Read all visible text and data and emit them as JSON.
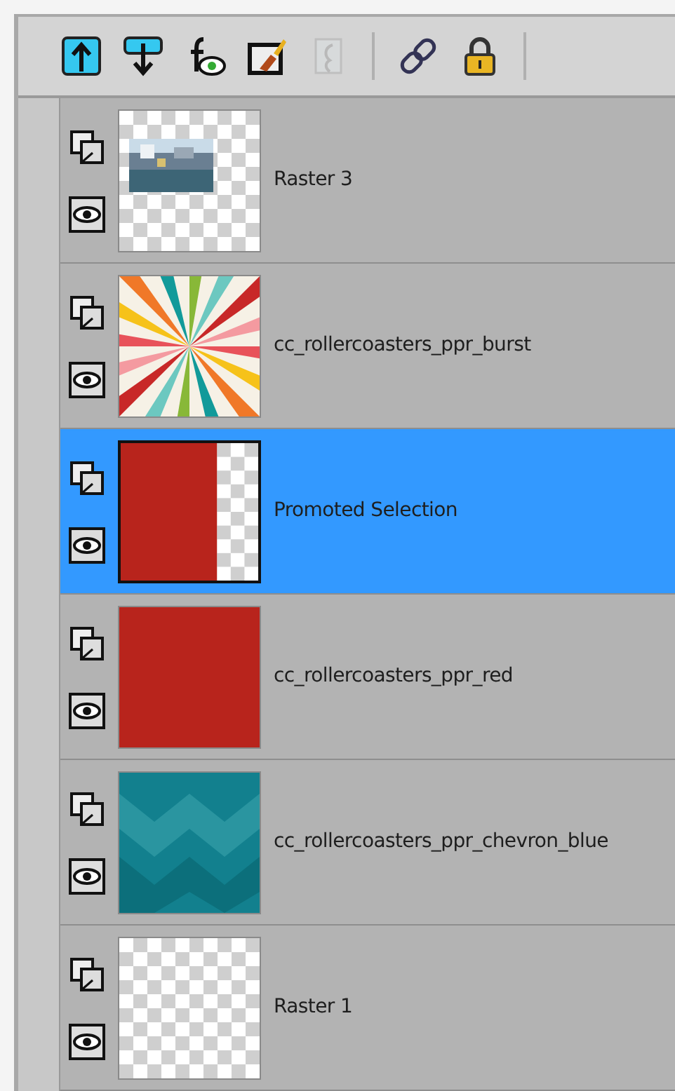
{
  "toolbar": [
    {
      "kind": "up",
      "disabled": false
    },
    {
      "kind": "down",
      "disabled": false
    },
    {
      "kind": "fx",
      "disabled": false
    },
    {
      "kind": "edit",
      "disabled": false
    },
    {
      "kind": "mask",
      "disabled": true
    },
    {
      "kind": "sep"
    },
    {
      "kind": "link",
      "disabled": false
    },
    {
      "kind": "lock",
      "disabled": false
    },
    {
      "kind": "sep"
    }
  ],
  "layers": [
    {
      "name": "Raster 3",
      "selected": false
    },
    {
      "name": "cc_rollercoasters_ppr_burst",
      "selected": false,
      "kind": "burst"
    },
    {
      "name": "Promoted Selection",
      "selected": true,
      "kind": "partial"
    },
    {
      "name": "cc_rollercoasters_ppr_red",
      "selected": false,
      "kind": "red"
    },
    {
      "name": "cc_rollercoasters_ppr_chevron_blue",
      "selected": false,
      "kind": "chevron"
    },
    {
      "name": "Raster 1",
      "selected": false,
      "kind": "empty"
    }
  ]
}
